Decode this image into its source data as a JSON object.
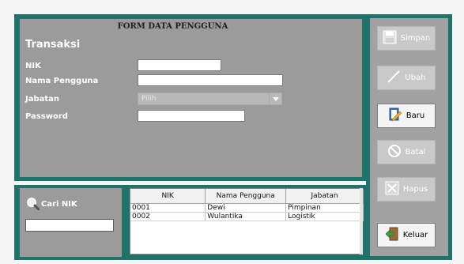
{
  "form": {
    "title": "FORM DATA PENGGUNA",
    "section": "Transaksi",
    "nik_label": "NIK",
    "nama_label": "Nama Pengguna",
    "jabatan_label": "Jabatan",
    "password_label": "Password",
    "nik_value": "",
    "nama_value": "",
    "password_value": "",
    "jabatan_selected": "Pilih"
  },
  "buttons": {
    "simpan": "Simpan",
    "ubah": "Ubah",
    "baru": "Baru",
    "batal": "Batal",
    "hapus": "Hapus",
    "keluar": "Keluar"
  },
  "search": {
    "label": "Cari NIK",
    "value": ""
  },
  "table": {
    "headers": [
      "NIK",
      "Nama Pengguna",
      "Jabatan"
    ],
    "rows": [
      [
        "0001",
        "Dewi",
        "Pimpinan"
      ],
      [
        "0002",
        "Wulantika",
        "Logistik"
      ]
    ]
  },
  "colors": {
    "frame": "#1f7368",
    "panel": "#9b9b9b",
    "disabled_button": "#c9c9c9"
  },
  "icons": [
    "save-icon",
    "edit-icon",
    "new-document-icon",
    "cancel-icon",
    "delete-icon",
    "exit-icon",
    "search-icon",
    "chevron-down-icon"
  ]
}
